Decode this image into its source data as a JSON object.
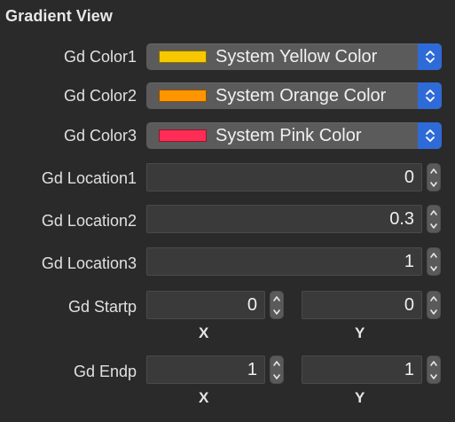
{
  "section": {
    "title": "Gradient View"
  },
  "colors": [
    {
      "label": "Gd Color1",
      "value": "System Yellow Color",
      "swatch": "#f5c800"
    },
    {
      "label": "Gd Color2",
      "value": "System Orange Color",
      "swatch": "#ff9500"
    },
    {
      "label": "Gd Color3",
      "value": "System Pink Color",
      "swatch": "#ff2d55"
    }
  ],
  "locations": [
    {
      "label": "Gd Location1",
      "value": "0"
    },
    {
      "label": "Gd Location2",
      "value": "0.3"
    },
    {
      "label": "Gd Location3",
      "value": "1"
    }
  ],
  "startp": {
    "label": "Gd Startp",
    "x": "0",
    "y": "0",
    "x_label": "X",
    "y_label": "Y"
  },
  "endp": {
    "label": "Gd Endp",
    "x": "1",
    "y": "1",
    "x_label": "X",
    "y_label": "Y"
  },
  "accent": "#2f6bd8"
}
